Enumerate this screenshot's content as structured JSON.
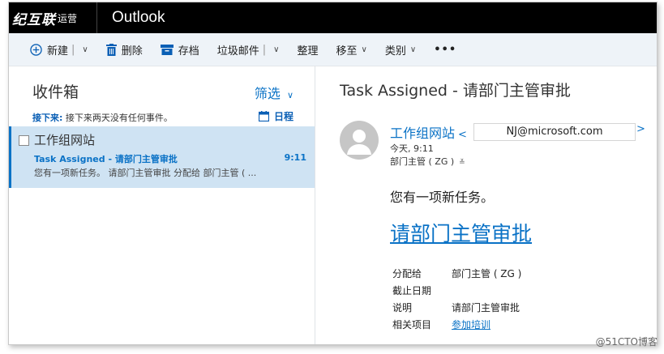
{
  "header": {
    "brand": "纪互联",
    "brand_suffix": "运营",
    "app_name": "Outlook"
  },
  "toolbar": {
    "new_label": "新建",
    "delete_label": "删除",
    "archive_label": "存档",
    "junk_label": "垃圾邮件",
    "sweep_label": "整理",
    "move_label": "移至",
    "category_label": "类别",
    "more_label": "•••"
  },
  "list_pane": {
    "folder_title": "收件箱",
    "filter_label": "筛选",
    "upcoming_label": "接下来:",
    "upcoming_text": "接下来两天没有任何事件。",
    "calendar_label": "日程",
    "items": [
      {
        "sender": "工作组网站",
        "subject": "Task Assigned - 请部门主管审批",
        "time": "9:11",
        "preview": "您有一项新任务。 请部门主管审批 分配给 部门主管 ( ..."
      }
    ]
  },
  "reading_pane": {
    "subject": "Task Assigned - 请部门主管审批",
    "from_name": "工作组网站",
    "from_open": "<",
    "from_email": "NJ@microsoft.com",
    "from_close": ">",
    "sent": "今天, 9:11",
    "to": "部门主管 ( ZG )",
    "body_intro": "您有一项新任务。",
    "task_link": "请部门主管审批",
    "details": [
      {
        "label": "分配给",
        "value": "部门主管 ( ZG )"
      },
      {
        "label": "截止日期",
        "value": ""
      },
      {
        "label": "说明",
        "value": "请部门主管审批"
      },
      {
        "label": "相关项目",
        "value": "参加培训"
      }
    ]
  },
  "watermark": "@51CTO博客",
  "colors": {
    "accent": "#0a72c6",
    "topbar": "#000000",
    "toolbar_bg": "#eef3f8",
    "selected_bg": "#cfe3f3"
  }
}
